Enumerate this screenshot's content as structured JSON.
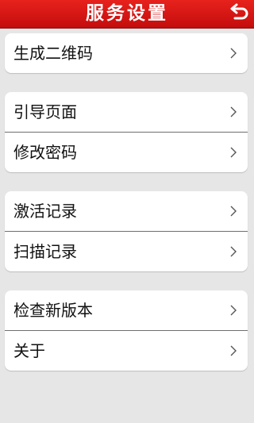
{
  "header": {
    "title": "服务设置",
    "back_icon": "back-arrow-icon",
    "background_color": "#d7171a"
  },
  "groups": [
    {
      "items": [
        {
          "label": "生成二维码",
          "icon": "chevron-right-icon"
        }
      ]
    },
    {
      "items": [
        {
          "label": "引导页面",
          "icon": "chevron-right-icon"
        },
        {
          "label": "修改密码",
          "icon": "chevron-right-icon"
        }
      ]
    },
    {
      "items": [
        {
          "label": "激活记录",
          "icon": "chevron-right-icon"
        },
        {
          "label": "扫描记录",
          "icon": "chevron-right-icon"
        }
      ]
    },
    {
      "items": [
        {
          "label": "检查新版本",
          "icon": "chevron-right-icon"
        },
        {
          "label": "关于",
          "icon": "chevron-right-icon"
        }
      ]
    }
  ]
}
